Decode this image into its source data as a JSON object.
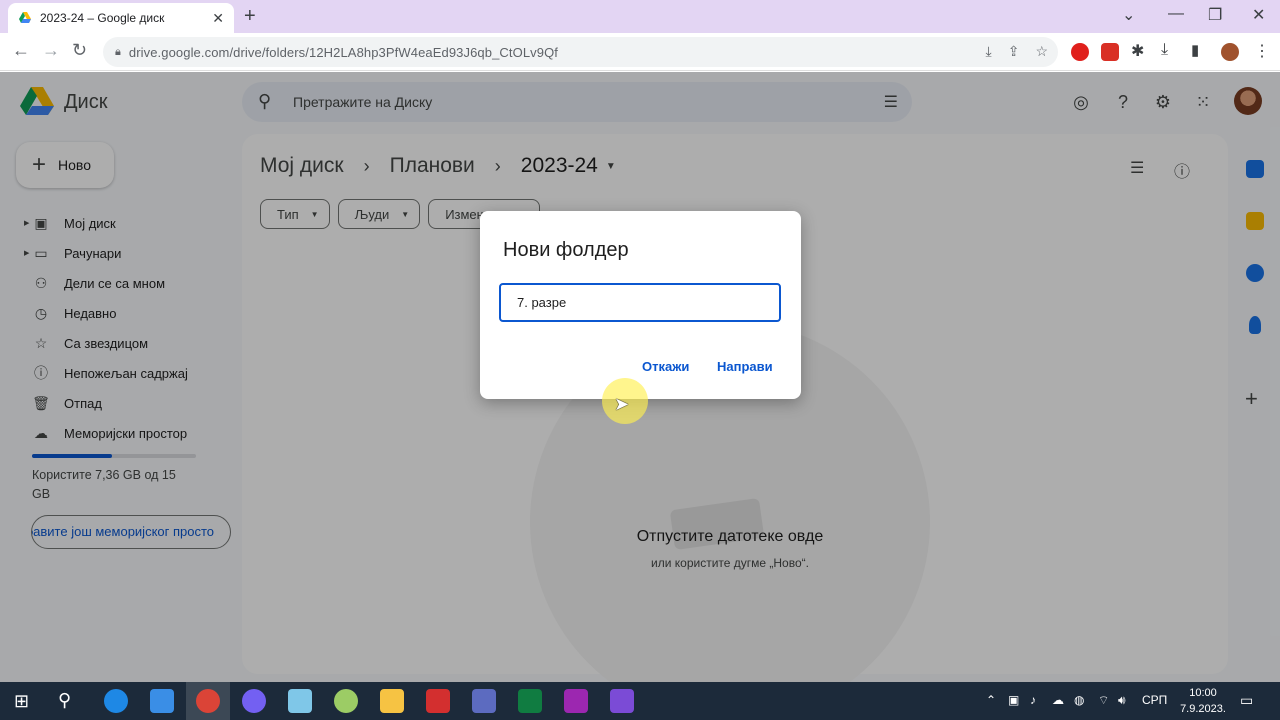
{
  "browser": {
    "tab_title": "2023-24 – Google диск",
    "url": "drive.google.com/drive/folders/12H2LA8hp3PfW4eaEd93J6qb_CtOLv9Qf"
  },
  "app": {
    "name": "Диск",
    "search_placeholder": "Претражите на Диску",
    "new_button": "Ново",
    "nav": [
      {
        "label": "Мој диск",
        "icon": "my-drive-icon"
      },
      {
        "label": "Рачунари",
        "icon": "computers-icon"
      },
      {
        "label": "Дели се са мном",
        "icon": "shared-icon"
      },
      {
        "label": "Недавно",
        "icon": "clock-icon"
      },
      {
        "label": "Са звездицом",
        "icon": "star-icon"
      },
      {
        "label": "Непожељан садржај",
        "icon": "spam-icon"
      },
      {
        "label": "Отпад",
        "icon": "trash-icon"
      },
      {
        "label": "Меморијски простор",
        "icon": "cloud-icon"
      }
    ],
    "storage_used_fraction": 0.49,
    "storage_text": "Користите 7,36 GB од 15 GB",
    "buy_storage": "бавите још меморијског просто"
  },
  "main": {
    "breadcrumb": [
      "Мој диск",
      "Планови",
      "2023-24"
    ],
    "filters": [
      "Тип",
      "Људи",
      "Измењено"
    ],
    "empty_title": "Отпустите датотеке овде",
    "empty_subtitle": "или користите дугме „Ново“."
  },
  "dialog": {
    "title": "Нови фолдер",
    "input_value": "7. разре",
    "cancel": "Откажи",
    "create": "Направи"
  },
  "taskbar": {
    "lang": "СРП",
    "time": "10:00",
    "date": "7.9.2023."
  },
  "colors": {
    "accent": "#0b57d0",
    "tabbar": "#e3d5f3",
    "taskbar": "#1c2a3a"
  }
}
